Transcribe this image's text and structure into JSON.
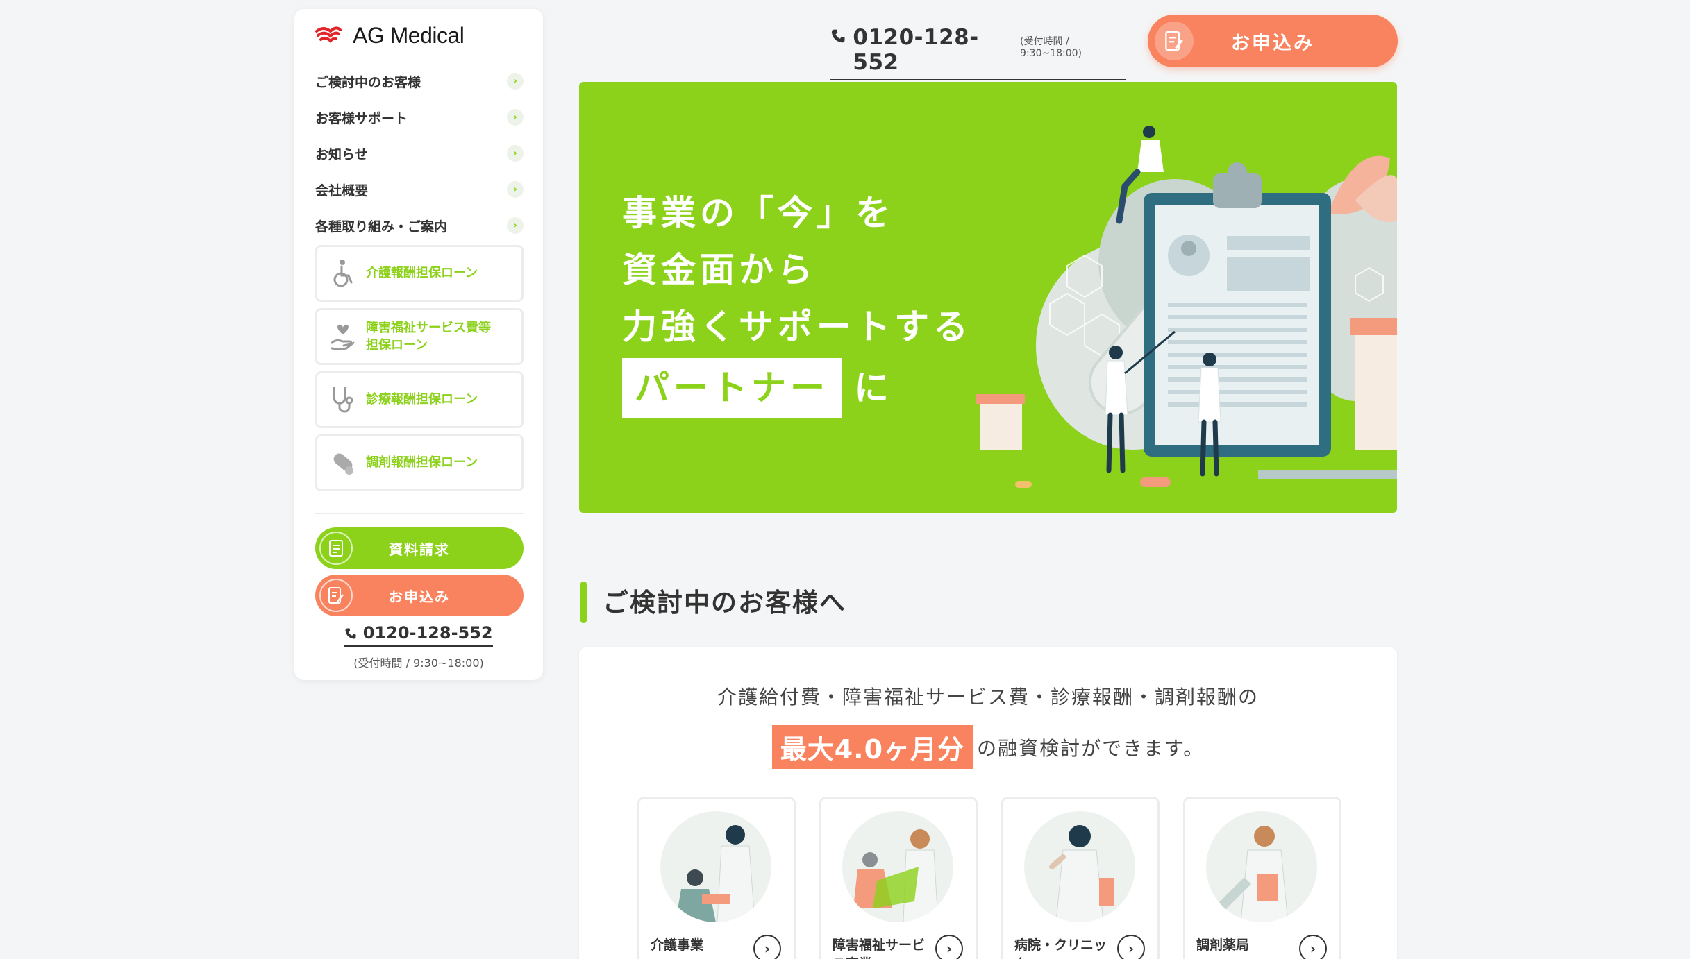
{
  "brand": {
    "name": "AG Medical",
    "accent_green": "#8cd21a",
    "accent_orange": "#f9835f",
    "logo_red": "#e0252b"
  },
  "sidebar": {
    "nav": [
      {
        "label": "ご検討中のお客様",
        "icon": "chevron-right-icon"
      },
      {
        "label": "お客様サポート",
        "icon": "chevron-right-icon"
      },
      {
        "label": "お知らせ",
        "icon": "chevron-right-icon"
      },
      {
        "label": "会社概要",
        "icon": "chevron-right-icon"
      },
      {
        "label": "各種取り組み・ご案内",
        "icon": "chevron-right-icon"
      }
    ],
    "loans": [
      {
        "label": "介護報酬担保ローン",
        "icon": "wheelchair-icon"
      },
      {
        "label_line1": "障害福祉サービス費等",
        "label_line2": "担保ローン",
        "icon": "heart-hand-icon"
      },
      {
        "label": "診療報酬担保ローン",
        "icon": "stethoscope-icon"
      },
      {
        "label": "調剤報酬担保ローン",
        "icon": "pill-icon"
      }
    ],
    "request_button": "資料請求",
    "apply_button": "お申込み",
    "phone": "0120-128-552",
    "hours": "(受付時間 / 9:30~18:00)"
  },
  "header": {
    "phone": "0120-128-552",
    "hours": "(受付時間 / 9:30~18:00)",
    "apply_button": "お申込み"
  },
  "hero": {
    "line1": "事業の「今」を",
    "line2": "資金面から",
    "line3": "力強くサポートする",
    "highlight": "パートナー",
    "line4_suffix": "に"
  },
  "section": {
    "title": "ご検討中のお客様へ",
    "text1": "介護給付費・障害福祉サービス費・診療報酬・調剤報酬の",
    "highlight": "最大4.0ヶ月分",
    "text2": "の融資検討ができます。",
    "categories": [
      {
        "label": "介護事業"
      },
      {
        "label": "障害福祉サービス事業"
      },
      {
        "label": "病院・クリニック"
      },
      {
        "label": "調剤薬局"
      }
    ]
  }
}
